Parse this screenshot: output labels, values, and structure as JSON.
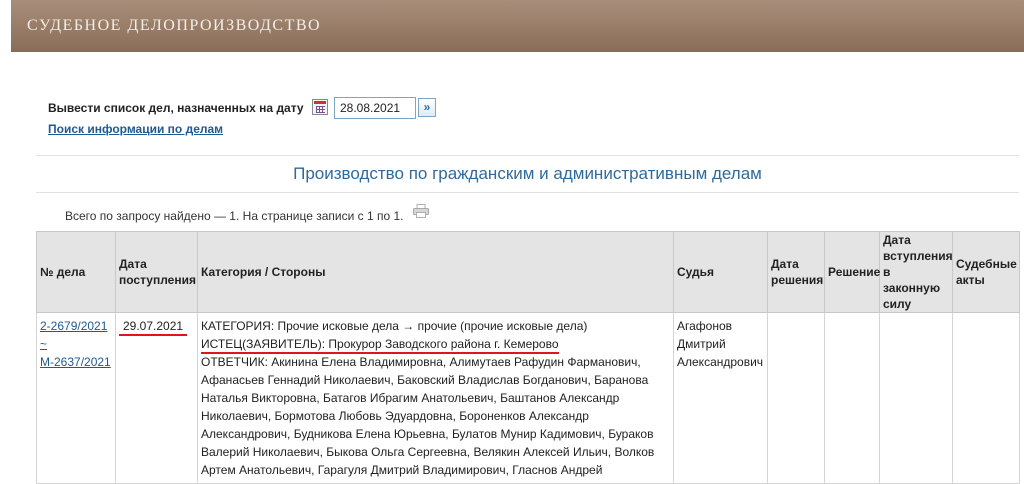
{
  "header": {
    "title": "СУДЕБНОЕ ДЕЛОПРОИЗВОДСТВО"
  },
  "filter": {
    "label": "Вывести список дел, назначенных на дату",
    "date_value": "28.08.2021",
    "go_icon": "double-chevron-right-icon",
    "calendar_icon": "calendar-icon",
    "search_link": "Поиск информации по делам"
  },
  "section": {
    "title": "Производство по гражданским и административным делам"
  },
  "results": {
    "summary": "Всего по запросу найдено — 1. На странице записи с 1 по 1.",
    "print_icon": "printer-icon"
  },
  "table": {
    "columns": {
      "case_no": "№ дела",
      "received": "Дата поступления",
      "category": "Категория / Стороны",
      "judge": "Судья",
      "decision_date": "Дата решения",
      "decision": "Решение",
      "effective_date": "Дата вступления в законную силу",
      "acts": "Судебные акты"
    },
    "rows": [
      {
        "case_no": "2-2679/2021",
        "case_sep": "~",
        "case_alt": "М-2637/2021",
        "received": "29.07.2021",
        "category": "КАТЕГОРИЯ: Прочие исковые дела → прочие (прочие исковые дела)",
        "plaintiff": "ИСТЕЦ(ЗАЯВИТЕЛЬ): Прокурор Заводского района г. Кемерово",
        "defendants": "ОТВЕТЧИК: Акинина Елена Владимировна, Алимутаев Рафудин Фарманович, Афанасьев Геннадий Николаевич, Баковский Владислав Богданович, Баранова Наталья Викторовна, Батагов Ибрагим Анатольевич, Баштанов Александр Николаевич, Бормотова Любовь Эдуардовна, Бороненков Александр Александрович, Будникова Елена Юрьевна, Булатов Мунир Кадимович, Бураков Валерий Николаевич, Быкова Ольга Сергеевна, Велякин Алексей Ильич, Волков Артем Анатольевич, Гарагуля Дмитрий Владимирович, Гласнов Андрей",
        "judge": "Агафонов Дмитрий Александрович",
        "decision_date": "",
        "decision": "",
        "effective_date": "",
        "acts": ""
      }
    ]
  },
  "colors": {
    "header_bg": "#8a6d59",
    "link": "#1e5a94",
    "title_blue": "#2e6a9c",
    "highlight_red": "#e0141e"
  }
}
